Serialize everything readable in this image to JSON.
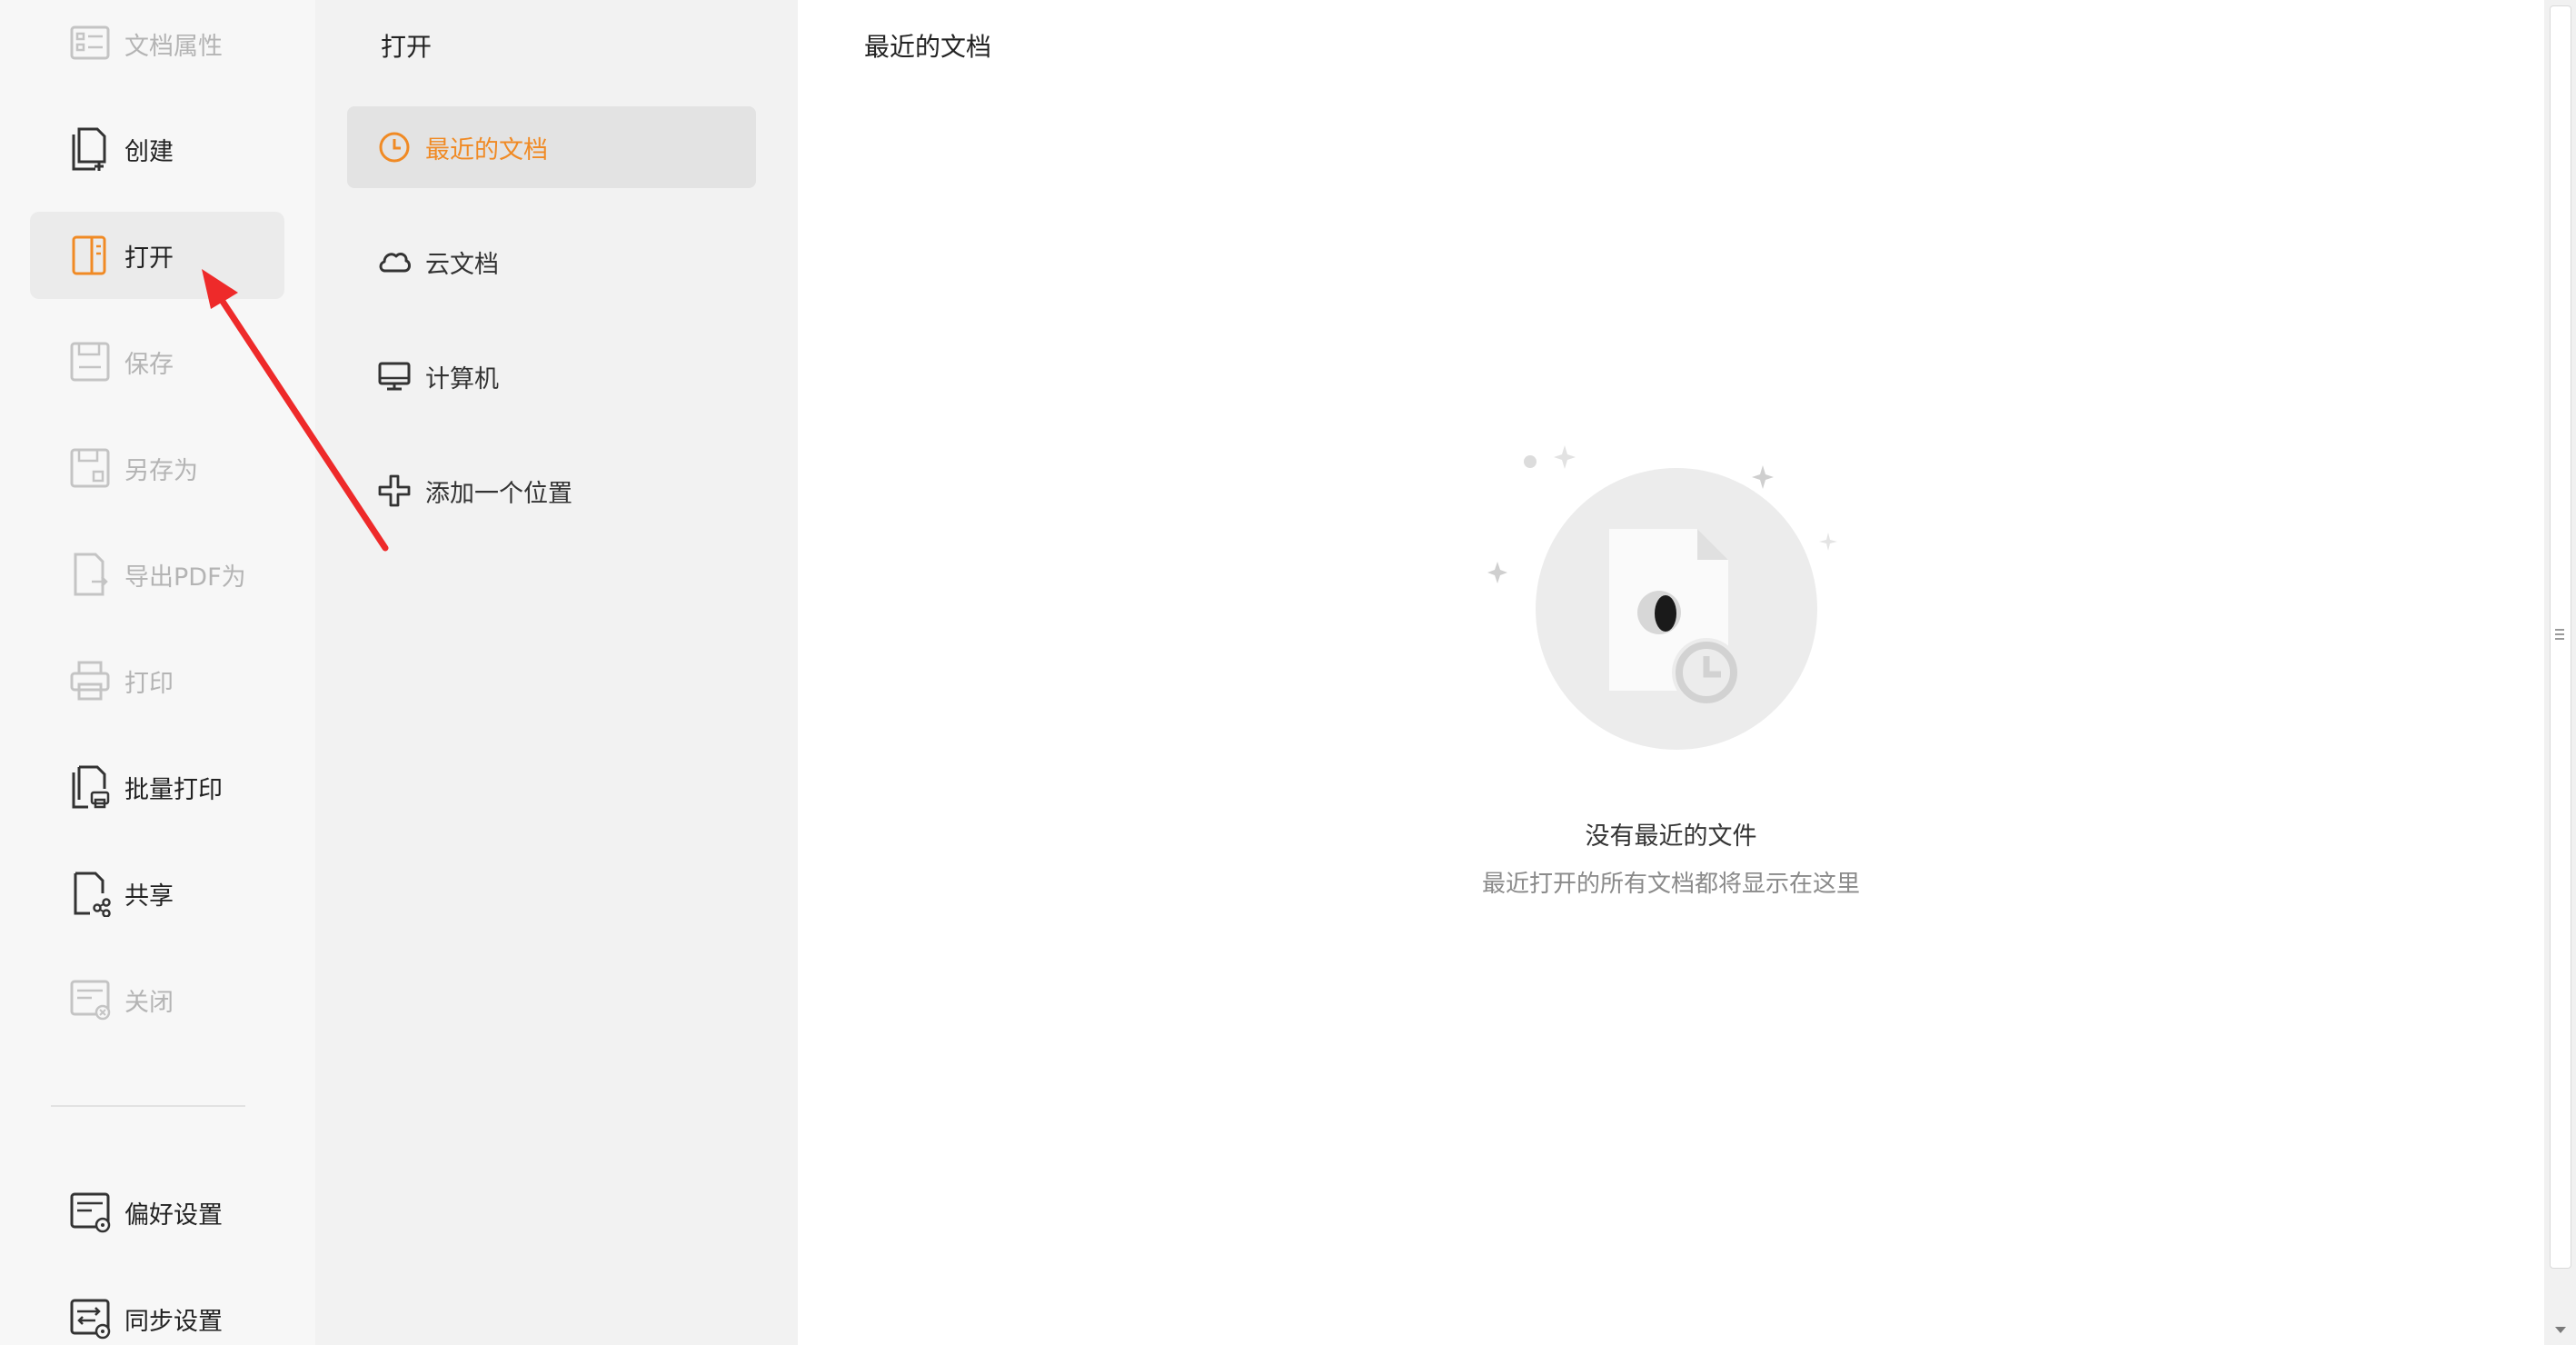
{
  "sidebar": {
    "items": [
      {
        "label": "文档属性",
        "icon": "document-properties-icon",
        "enabled": false
      },
      {
        "label": "创建",
        "icon": "create-document-icon",
        "enabled": true
      },
      {
        "label": "打开",
        "icon": "open-folder-icon",
        "enabled": true,
        "selected": true
      },
      {
        "label": "保存",
        "icon": "save-icon",
        "enabled": false
      },
      {
        "label": "另存为",
        "icon": "save-as-icon",
        "enabled": false
      },
      {
        "label": "导出PDF为",
        "icon": "export-pdf-icon",
        "enabled": false
      },
      {
        "label": "打印",
        "icon": "print-icon",
        "enabled": false
      },
      {
        "label": "批量打印",
        "icon": "batch-print-icon",
        "enabled": true
      },
      {
        "label": "共享",
        "icon": "share-icon",
        "enabled": true
      },
      {
        "label": "关闭",
        "icon": "close-document-icon",
        "enabled": false
      }
    ],
    "bottom_items": [
      {
        "label": "偏好设置",
        "icon": "preferences-icon",
        "enabled": true
      },
      {
        "label": "同步设置",
        "icon": "sync-settings-icon",
        "enabled": true
      }
    ]
  },
  "open_panel": {
    "title": "打开",
    "items": [
      {
        "label": "最近的文档",
        "icon": "clock-icon",
        "selected": true
      },
      {
        "label": "云文档",
        "icon": "cloud-icon"
      },
      {
        "label": "计算机",
        "icon": "computer-icon"
      },
      {
        "label": "添加一个位置",
        "icon": "add-location-icon"
      }
    ]
  },
  "main": {
    "title": "最近的文档",
    "empty_state": {
      "title": "没有最近的文件",
      "description": "最近打开的所有文档都将显示在这里"
    }
  },
  "colors": {
    "accent": "#f08a24",
    "annotation_arrow": "#ee2a2a"
  }
}
